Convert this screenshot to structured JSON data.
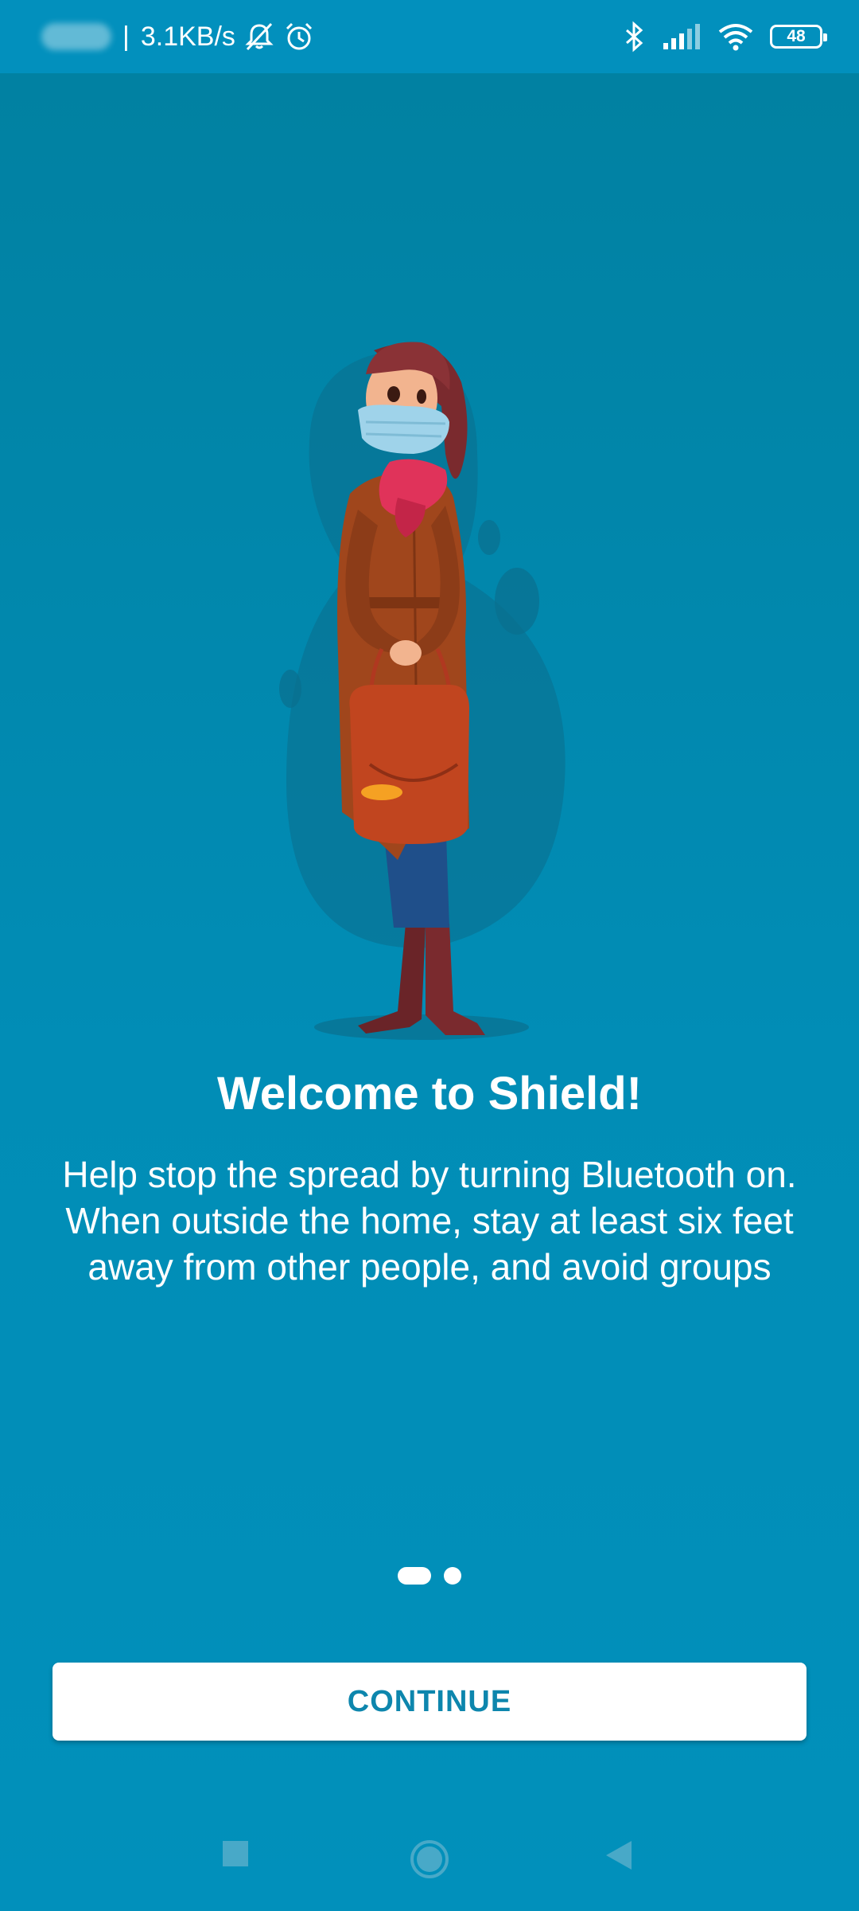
{
  "status_bar": {
    "network_speed": "3.1KB/s",
    "separator": "|",
    "battery_level": "48",
    "icons": [
      "silent-icon",
      "alarm-icon",
      "bluetooth-icon",
      "signal-icon",
      "wifi-icon",
      "battery-icon"
    ]
  },
  "welcome": {
    "title": "Welcome to Shield!",
    "body": "Help stop the spread by turning Bluetooth on. When outside the home, stay at least six feet away from other people, and avoid groups"
  },
  "pager": {
    "current_page": 1,
    "total_pages": 2
  },
  "actions": {
    "continue_label": "CONTINUE"
  },
  "colors": {
    "background": "#018db6",
    "button_text": "#0d86ad",
    "accent": "#ffffff"
  },
  "nav_bar": {
    "icons": [
      "recents-icon",
      "home-icon",
      "back-icon"
    ]
  }
}
